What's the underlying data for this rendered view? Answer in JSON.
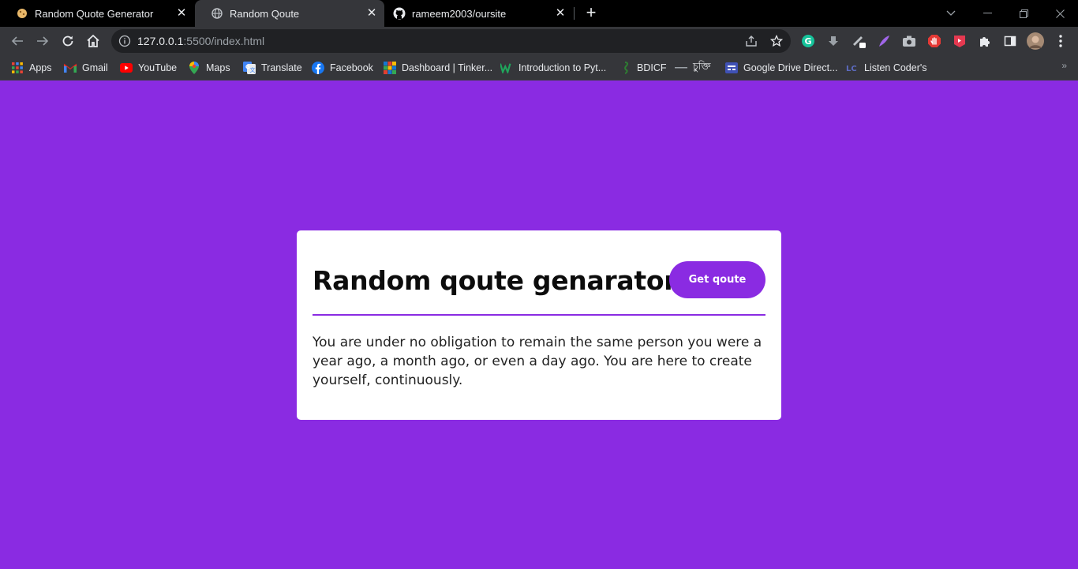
{
  "browser": {
    "tabs": [
      {
        "title": "Random Quote Generator",
        "active": false
      },
      {
        "title": "Random Qoute",
        "active": true
      },
      {
        "title": "rameem2003/oursite",
        "active": false
      }
    ],
    "new_tab_label": "+",
    "url_host": "127.0.0.1",
    "url_rest": ":5500/index.html",
    "bookmarks": [
      {
        "label": "Apps",
        "icon": "apps-grid-icon"
      },
      {
        "label": "Gmail",
        "icon": "gmail-icon"
      },
      {
        "label": "YouTube",
        "icon": "youtube-icon"
      },
      {
        "label": "Maps",
        "icon": "maps-pin-icon"
      },
      {
        "label": "Translate",
        "icon": "translate-icon"
      },
      {
        "label": "Facebook",
        "icon": "facebook-icon"
      },
      {
        "label": "Dashboard | Tinker...",
        "icon": "tinkercad-icon"
      },
      {
        "label": "Introduction to Pyt...",
        "icon": "w-icon"
      },
      {
        "label": "BDICF",
        "icon": "bdicf-icon"
      },
      {
        "label": "চুক্তি",
        "icon": "dash-icon"
      },
      {
        "label": "Google Drive Direct...",
        "icon": "drive-icon"
      },
      {
        "label": "Listen Coder's",
        "icon": "lc-icon"
      }
    ]
  },
  "page": {
    "heading": "Random qoute genarator",
    "button_label": "Get qoute",
    "quote": "You are under no obligation to remain the same person you were a year ago, a month ago, or even a day ago. You are here to create yourself, continuously."
  },
  "colors": {
    "accent": "#8a2be2",
    "card": "#ffffff",
    "chrome_dark": "#000000",
    "chrome_toolbar": "#35363a"
  }
}
